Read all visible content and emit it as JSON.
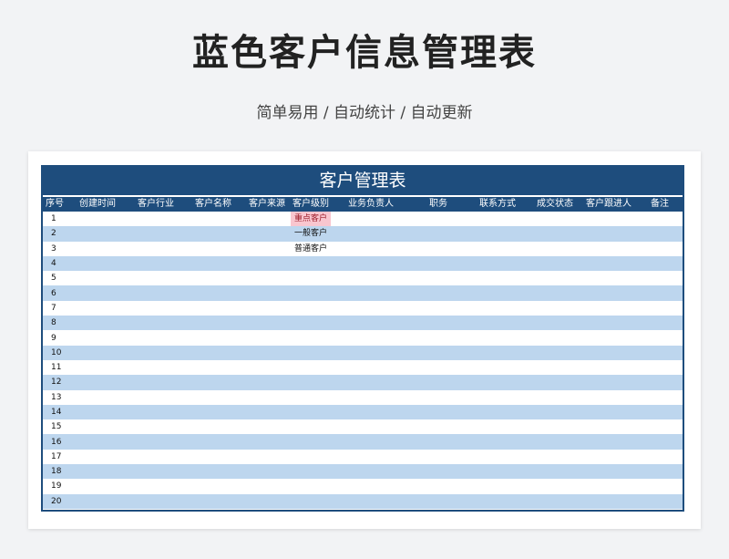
{
  "page": {
    "title": "蓝色客户信息管理表",
    "subtitle": "简单易用  /  自动统计  /  自动更新"
  },
  "sheet": {
    "title": "客户管理表",
    "columns": [
      "序号",
      "创建时间",
      "客户行业",
      "客户名称",
      "客户来源",
      "客户级别",
      "业务负责人",
      "职务",
      "联系方式",
      "成交状态",
      "客户跟进人",
      "备注"
    ],
    "rows": [
      {
        "no": "1",
        "level": "重点客户",
        "level_highlight": true
      },
      {
        "no": "2",
        "level": "一般客户"
      },
      {
        "no": "3",
        "level": "普通客户"
      },
      {
        "no": "4"
      },
      {
        "no": "5"
      },
      {
        "no": "6"
      },
      {
        "no": "7"
      },
      {
        "no": "8"
      },
      {
        "no": "9"
      },
      {
        "no": "10"
      },
      {
        "no": "11"
      },
      {
        "no": "12"
      },
      {
        "no": "13"
      },
      {
        "no": "14"
      },
      {
        "no": "15"
      },
      {
        "no": "16"
      },
      {
        "no": "17"
      },
      {
        "no": "18"
      },
      {
        "no": "19"
      },
      {
        "no": "20"
      }
    ],
    "colors": {
      "header": "#1e4d7d",
      "stripe": "#bdd6ee",
      "highlight": "#f9c6cf"
    }
  }
}
